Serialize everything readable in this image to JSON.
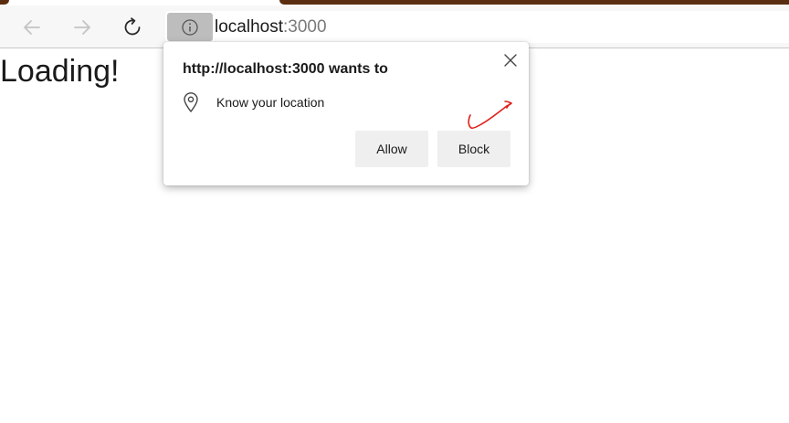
{
  "browser": {
    "address_bar": {
      "url_host": "localhost",
      "url_port": ":3000"
    },
    "icons": {
      "back": "arrow-left-icon",
      "forward": "arrow-right-icon",
      "reload": "refresh-icon",
      "site_info": "info-icon"
    }
  },
  "page": {
    "text": "Loading!"
  },
  "permission_prompt": {
    "title": "http://localhost:3000 wants to",
    "permission_label": "Know your location",
    "permission_icon": "location-pin-icon",
    "allow_label": "Allow",
    "block_label": "Block",
    "close_icon": "close-icon"
  },
  "annotation": {
    "color": "#e0201b",
    "mark": "checkmark-annotation"
  },
  "colors": {
    "window_accent": "#5a2d10",
    "toolbar_bg": "#f7f7f7",
    "site_info_bg": "#bdbdbd",
    "button_bg": "#efefef"
  }
}
